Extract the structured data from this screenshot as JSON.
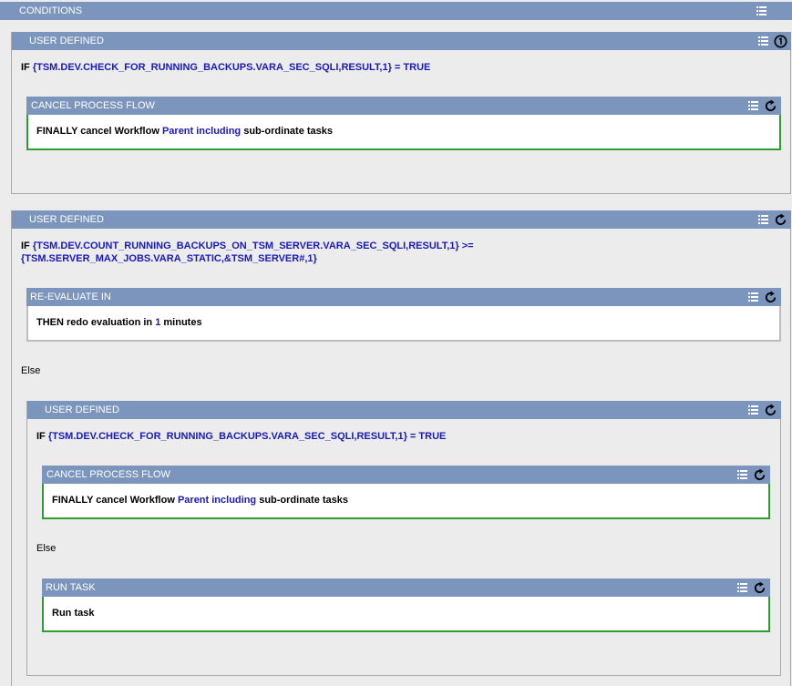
{
  "conditions": {
    "title": "CONDITIONS"
  },
  "block1": {
    "title": "USER DEFINED",
    "if_kw": "IF",
    "condition": "{TSM.DEV.CHECK_FOR_RUNNING_BACKUPS.VARA_SEC_SQLI,RESULT,1} = TRUE",
    "inner": {
      "title": "CANCEL PROCESS FLOW",
      "finally_kw": "FINALLY cancel Workflow",
      "target": "Parent including",
      "rest": "sub-ordinate tasks"
    }
  },
  "block2": {
    "title": "USER DEFINED",
    "if_kw": "IF",
    "condition_line1": "{TSM.DEV.COUNT_RUNNING_BACKUPS_ON_TSM_SERVER.VARA_SEC_SQLI,RESULT,1} >=",
    "condition_line2": "{TSM.SERVER_MAX_JOBS.VARA_STATIC,&TSM_SERVER#,1}",
    "reeval": {
      "title": "RE-EVALUATE IN",
      "then_kw": "THEN redo evaluation in",
      "value": "1",
      "unit": "minutes"
    },
    "else_label": "Else",
    "nested": {
      "title": "USER DEFINED",
      "if_kw": "IF",
      "condition": "{TSM.DEV.CHECK_FOR_RUNNING_BACKUPS.VARA_SEC_SQLI,RESULT,1} = TRUE",
      "cancel": {
        "title": "CANCEL PROCESS FLOW",
        "finally_kw": "FINALLY cancel Workflow",
        "target": "Parent including",
        "rest": "sub-ordinate tasks"
      },
      "else_label": "Else",
      "run": {
        "title": "RUN TASK",
        "text": "Run task"
      }
    }
  },
  "colors": {
    "header": "#7b95bd",
    "keyword_blue": "#1a1ab8",
    "active_border": "#2e9e2e",
    "background": "#ececec"
  },
  "icons": [
    "menu-icon",
    "refresh-icon",
    "badge-icon"
  ]
}
